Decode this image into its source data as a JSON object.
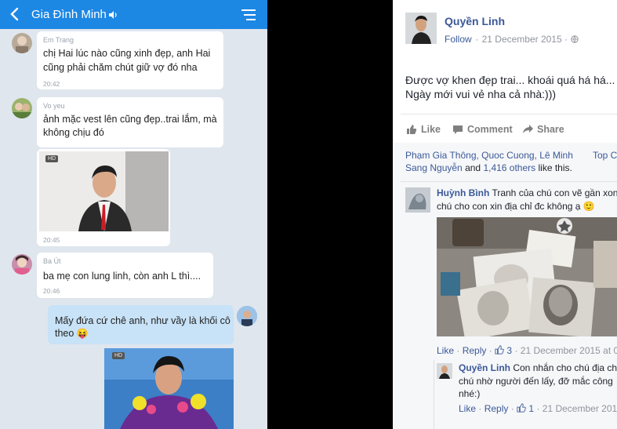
{
  "chat": {
    "title": "Gia Đình Minh",
    "messages": [
      {
        "sender": "Em Trang",
        "line1": "chị Hai lúc nào cũng xinh đẹp, anh Hai",
        "line2": "cũng phải chăm chút giữ vợ đó nha",
        "time": "20:42"
      },
      {
        "sender": "Vo yeu",
        "line1": "ảnh mặc vest lên cũng đẹp..trai lắm, mà",
        "line2": "không chịu đó"
      },
      {
        "image_badge": "HD",
        "time": "20:45"
      },
      {
        "sender": "Ba Út",
        "line1": "ba mẹ con lung linh, còn anh L thì....",
        "time": "20:46"
      },
      {
        "line1": "Mấy đứa cứ chê anh, như vầy là khối cô",
        "line2": "theo",
        "emoji": "😝"
      },
      {
        "image_badge": "HD"
      }
    ]
  },
  "fb": {
    "author": "Quyền Linh",
    "follow": "Follow",
    "dot": "·",
    "date": "21 December 2015 ·",
    "post_line1": "Được vợ khen đẹp trai... khoái quá há há...",
    "post_line2": "Ngày mới vui vẻ nha cả nhà:)))",
    "actions": {
      "like": "Like",
      "comment": "Comment",
      "share": "Share"
    },
    "likes_line1": "Phạm Gia Thông, Quoc Cuong, Lê Minh",
    "likes_top": "Top C",
    "likes_line2a": "Sang Nguyễn",
    "likes_line2b": " and ",
    "likes_line2c": "1,416 others",
    "likes_line2d": " like this.",
    "comment1": {
      "name": "Huỳnh Bình",
      "line1": "Tranh của chú con vẽ gần xon",
      "line2": "chú cho con xin địa chỉ đc không ạ",
      "emoji": "🙂",
      "like": "Like",
      "reply": "Reply",
      "count": "3",
      "date": "· 21 December 2015 at 0"
    },
    "reply1": {
      "name": "Quyền Linh",
      "line1": "Con nhắn cho chú địa ch",
      "line2": "chú nhờ người đến lấy, đỡ mắc công",
      "line3": "nhé:)",
      "like": "Like",
      "reply": "Reply",
      "count": "1",
      "date": "· 21 December 2015"
    }
  }
}
